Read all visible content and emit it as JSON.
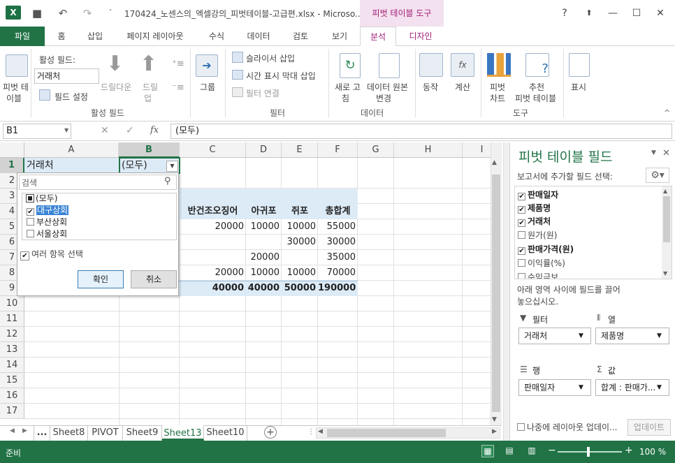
{
  "window": {
    "title": "170424_노센스의_엑셀강의_피벗테이블-고급편.xlsx - Microso...",
    "context_tab_header": "피벗 테이블 도구",
    "help": "?",
    "minimize": "—",
    "maximize": "☐",
    "close": "✕"
  },
  "tabs": [
    "파일",
    "홈",
    "삽입",
    "페이지 레이아웃",
    "수식",
    "데이터",
    "검토",
    "보기",
    "분석",
    "디자인"
  ],
  "ribbon": {
    "pivottable_label_1": "피벗 테",
    "pivottable_label_2": "이블",
    "active_field_label": "활성 필드:",
    "active_field_value": "거래처",
    "field_settings": "필드 설정",
    "drill_down": "드릴다운",
    "drill_up_1": "드릴",
    "drill_up_2": "업",
    "group": "그룹",
    "insert_slicer": "슬라이서 삽입",
    "insert_timeline": "시간 표시 막대 삽입",
    "filter_connections": "필터 연결",
    "refresh_1": "새로 고",
    "refresh_2": "침",
    "change_source_1": "데이터 원본",
    "change_source_2": "변경",
    "actions": "동작",
    "calculations": "계산",
    "pivotchart_1": "피벗",
    "pivotchart_2": "차트",
    "recommended_1": "추천",
    "recommended_2": "피벗 테이블",
    "show": "표시",
    "groups": {
      "active_field": "활성 필드",
      "filter": "필터",
      "data": "데이터",
      "tools": "도구"
    }
  },
  "formula_bar": {
    "name_box": "B1",
    "cancel": "✕",
    "enter": "✓",
    "fx": "fx",
    "content": "(모두)"
  },
  "grid": {
    "columns": [
      "A",
      "B",
      "C",
      "D",
      "E",
      "F",
      "G",
      "H",
      "I"
    ],
    "rows": [
      "1",
      "2",
      "3",
      "4",
      "5",
      "6",
      "7",
      "8",
      "9",
      "10",
      "11",
      "12",
      "13",
      "14",
      "15",
      "16",
      "17"
    ],
    "a1": "거래처",
    "b1": "(모두)",
    "headers": [
      "반건조오징어",
      "아귀포",
      "쥐포",
      "총합계"
    ],
    "row5": [
      "20000",
      "10000",
      "10000",
      "55000"
    ],
    "row6": [
      "",
      "",
      "30000",
      "30000"
    ],
    "row7": [
      "",
      "20000",
      "",
      "35000"
    ],
    "row8": [
      "20000",
      "10000",
      "10000",
      "70000"
    ],
    "row9": [
      "40000",
      "40000",
      "50000",
      "190000"
    ]
  },
  "filter_dropdown": {
    "search_placeholder": "검색",
    "items": [
      {
        "label": "(모두)",
        "state": "partial"
      },
      {
        "label": "대구상회",
        "state": "checked"
      },
      {
        "label": "부산상회",
        "state": "unchecked"
      },
      {
        "label": "서울상회",
        "state": "unchecked"
      }
    ],
    "multi_select": "여러 항목 선택",
    "ok": "확인",
    "cancel": "취소"
  },
  "sheet_tabs": {
    "more": "...",
    "tabs": [
      "Sheet8",
      "PIVOT",
      "Sheet9",
      "Sheet13",
      "Sheet10"
    ],
    "active": "Sheet13"
  },
  "pivot_panel": {
    "title": "피벗 테이블 필드",
    "subtitle": "보고서에 추가할 필드 선택:",
    "fields": [
      {
        "label": "판매일자",
        "checked": true
      },
      {
        "label": "제품명",
        "checked": true
      },
      {
        "label": "거래처",
        "checked": true
      },
      {
        "label": "원가(원)",
        "checked": false
      },
      {
        "label": "판매가격(원)",
        "checked": true
      },
      {
        "label": "이익률(%)",
        "checked": false
      },
      {
        "label": "수익금보",
        "checked": false
      }
    ],
    "drag_hint_1": "아래 영역 사이에 필드를 끌어",
    "drag_hint_2": "놓으십시오.",
    "filter_area": "필터",
    "column_area": "열",
    "row_area": "행",
    "value_area": "값",
    "filter_value": "거래처",
    "column_value": "제품명",
    "row_value": "판매일자",
    "value_value": "합계 : 판매가...",
    "defer_update": "나중에 레이아웃 업데이...",
    "update_button": "업데이트"
  },
  "status": {
    "ready": "준비",
    "zoom": "100 %"
  },
  "colors": {
    "excel_green": "#217346",
    "context_pink": "#a01d78",
    "selection_blue": "#ddebf7"
  }
}
